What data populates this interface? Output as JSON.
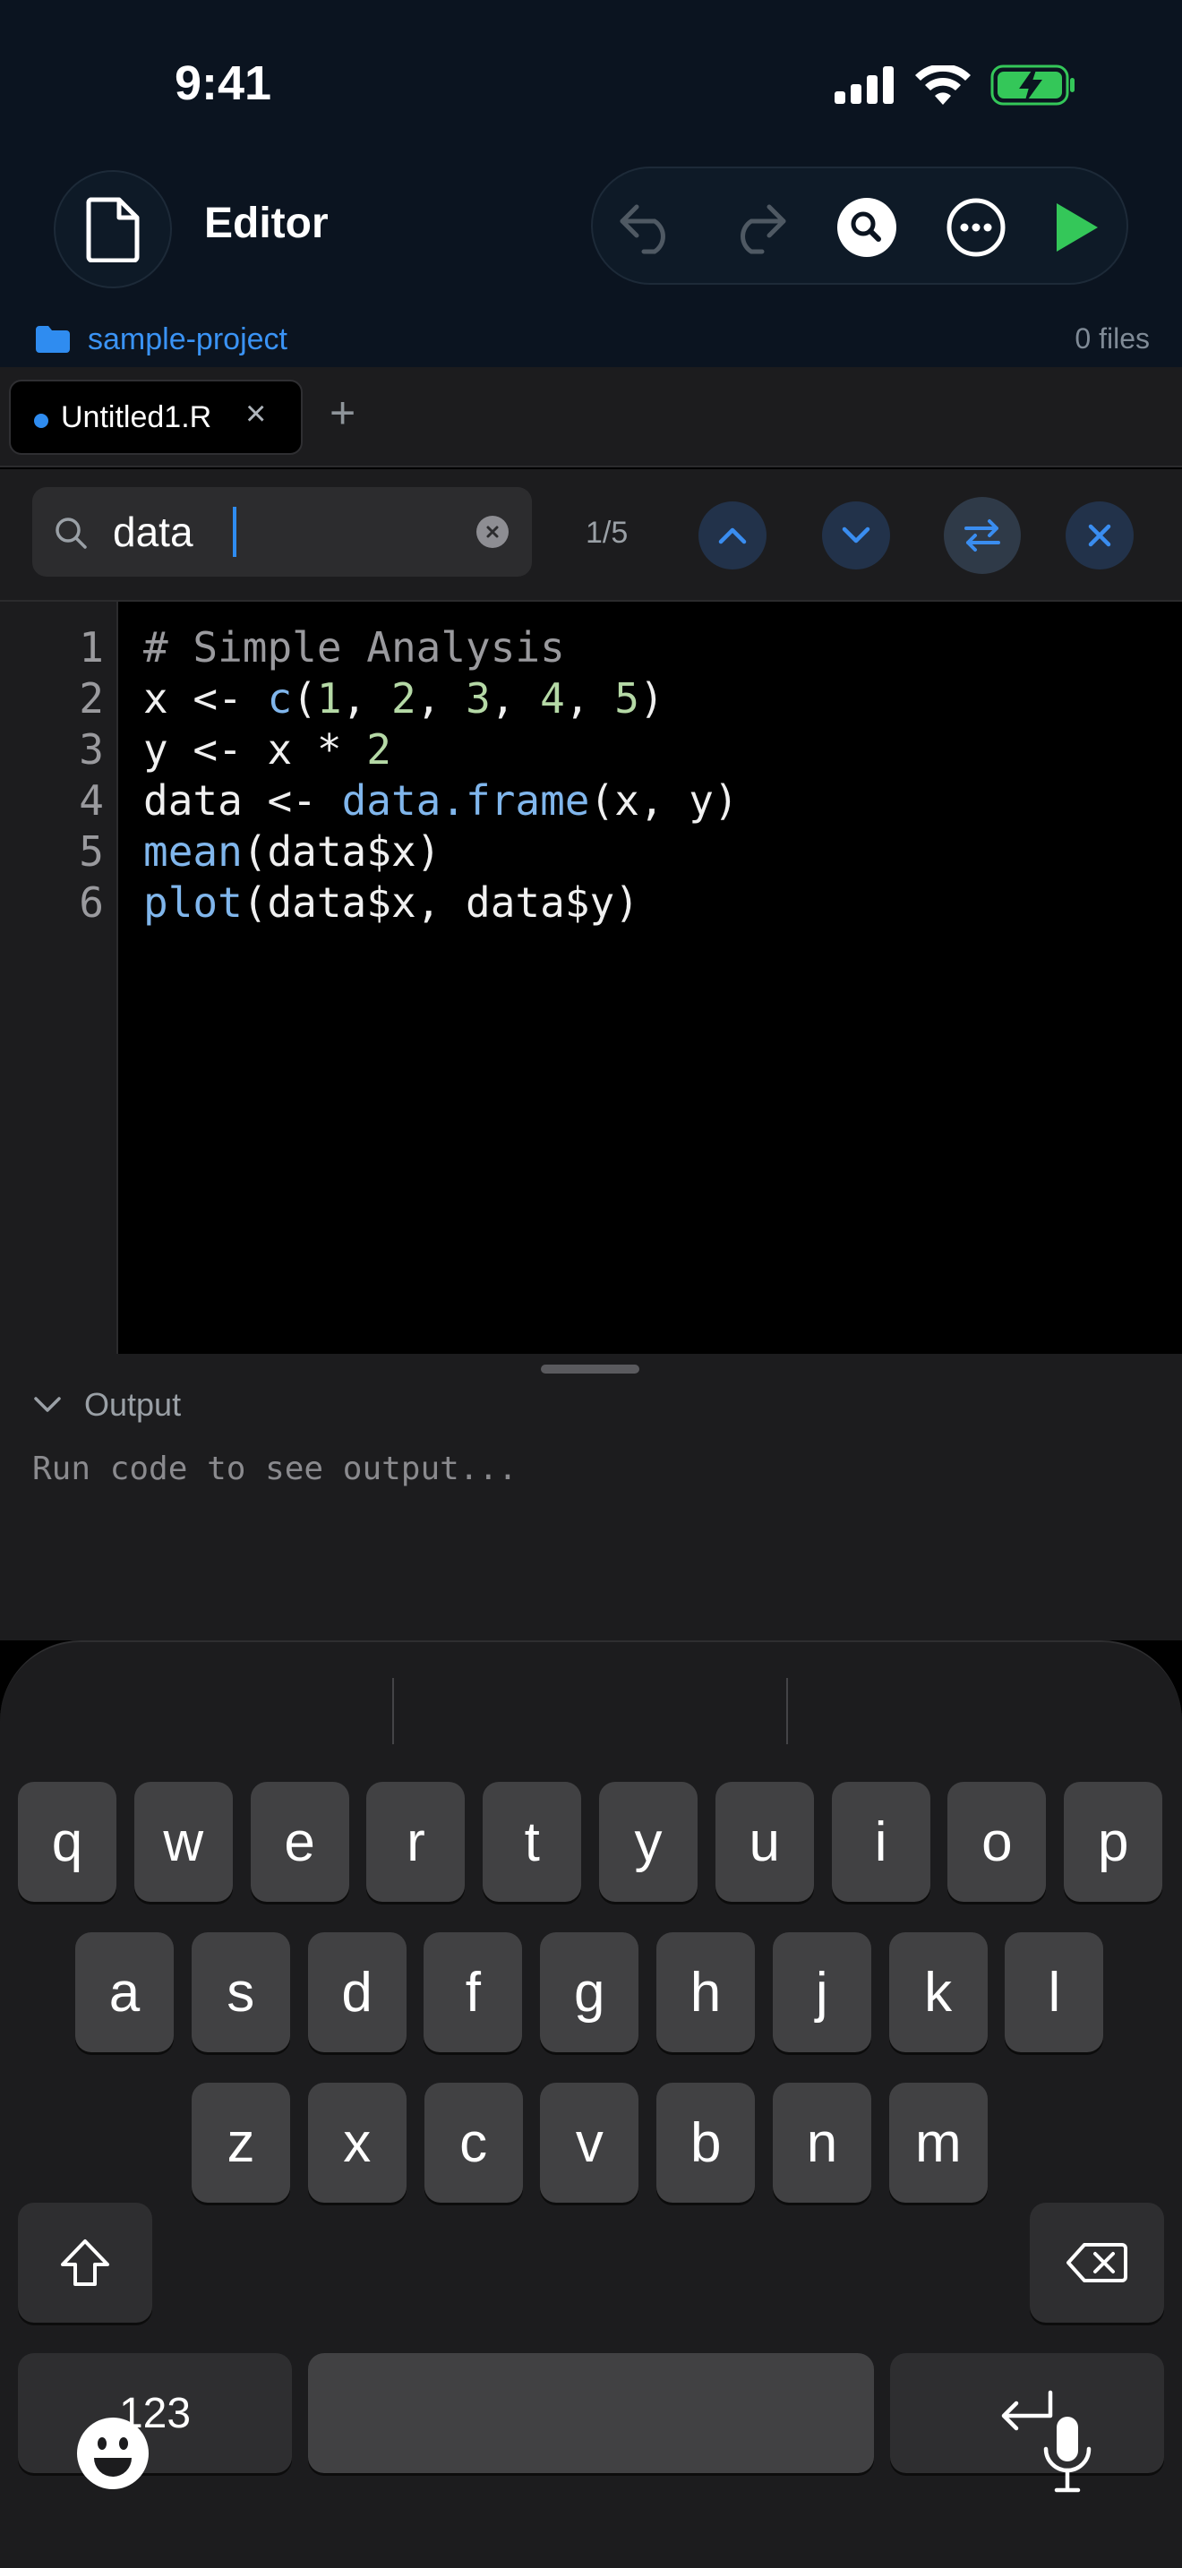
{
  "status_bar": {
    "time": "9:41"
  },
  "header": {
    "title": "Editor",
    "project_name": "sample-project",
    "file_count": "0 files"
  },
  "tabs": [
    {
      "label": "Untitled1.R",
      "close": "×"
    }
  ],
  "tab_add": "+",
  "search": {
    "query": "data",
    "match_count": "1/5"
  },
  "editor": {
    "line_numbers": [
      "1",
      "2",
      "3",
      "4",
      "5",
      "6"
    ],
    "lines": [
      [
        {
          "t": "# Simple Analysis",
          "k": "comment"
        }
      ],
      [
        {
          "t": "x <- ",
          "k": "plain"
        },
        {
          "t": "c",
          "k": "func"
        },
        {
          "t": "(",
          "k": "plain"
        },
        {
          "t": "1",
          "k": "num"
        },
        {
          "t": ", ",
          "k": "plain"
        },
        {
          "t": "2",
          "k": "num"
        },
        {
          "t": ", ",
          "k": "plain"
        },
        {
          "t": "3",
          "k": "num"
        },
        {
          "t": ", ",
          "k": "plain"
        },
        {
          "t": "4",
          "k": "num"
        },
        {
          "t": ", ",
          "k": "plain"
        },
        {
          "t": "5",
          "k": "num"
        },
        {
          "t": ")",
          "k": "plain"
        }
      ],
      [
        {
          "t": "y <- x * ",
          "k": "plain"
        },
        {
          "t": "2",
          "k": "num"
        }
      ],
      [
        {
          "t": "data <- ",
          "k": "plain"
        },
        {
          "t": "data.frame",
          "k": "func"
        },
        {
          "t": "(x, y)",
          "k": "plain"
        }
      ],
      [
        {
          "t": "mean",
          "k": "func"
        },
        {
          "t": "(data$x)",
          "k": "plain"
        }
      ],
      [
        {
          "t": "plot",
          "k": "func"
        },
        {
          "t": "(data$x, data$y)",
          "k": "plain"
        }
      ]
    ]
  },
  "output": {
    "title": "Output",
    "placeholder": "Run code to see output..."
  },
  "keyboard": {
    "row1": [
      "q",
      "w",
      "e",
      "r",
      "t",
      "y",
      "u",
      "i",
      "o",
      "p"
    ],
    "row2": [
      "a",
      "s",
      "d",
      "f",
      "g",
      "h",
      "j",
      "k",
      "l"
    ],
    "row3": [
      "z",
      "x",
      "c",
      "v",
      "b",
      "n",
      "m"
    ],
    "numbers_label": "123"
  },
  "colors": {
    "accent": "#2f8cf0",
    "run": "#34c759",
    "header_bg": "#0b1420"
  }
}
